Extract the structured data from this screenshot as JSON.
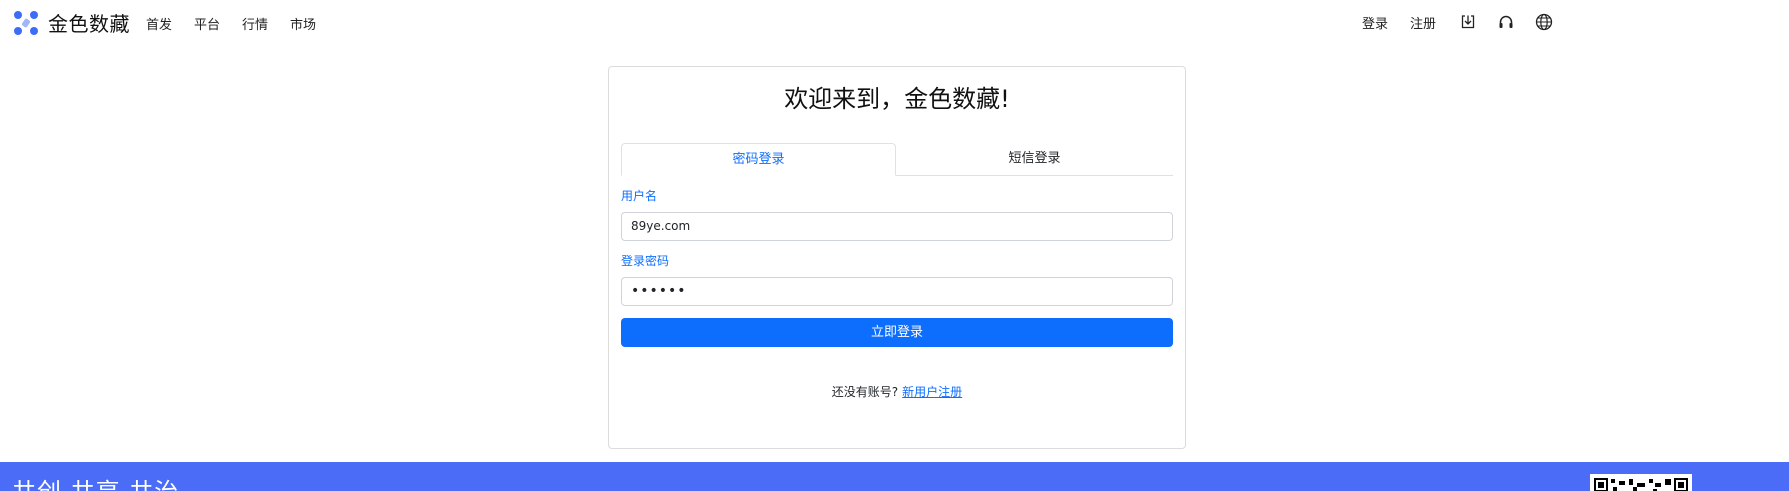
{
  "header": {
    "brand": "金色数藏",
    "nav": [
      "首发",
      "平台",
      "行情",
      "市场"
    ],
    "login": "登录",
    "register": "注册",
    "icons": [
      "download-icon",
      "headset-icon",
      "globe-icon"
    ]
  },
  "card": {
    "title": "欢迎来到，金色数藏!",
    "tabs": [
      "密码登录",
      "短信登录"
    ],
    "username_label": "用户名",
    "username_value": "89ye.com",
    "password_label": "登录密码",
    "password_value": "••••••",
    "submit": "立即登录",
    "register_prompt": "还没有账号?",
    "register_link": "新用户注册"
  },
  "footer": {
    "slogan": "共创 共享 共治"
  },
  "colors": {
    "accent": "#0d6efd",
    "footer_bg": "#4a6cf7"
  }
}
